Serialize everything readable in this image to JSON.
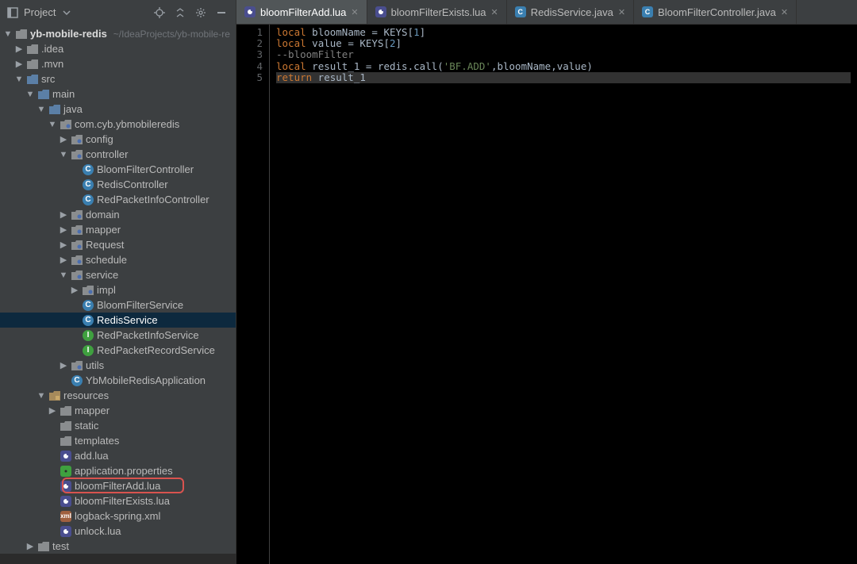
{
  "sidebar": {
    "title": "Project",
    "root": {
      "name": "yb-mobile-redis",
      "path": "~/IdeaProjects/yb-mobile-re"
    }
  },
  "tree": [
    {
      "depth": 1,
      "expand": "down",
      "icon": "folder",
      "label": ".idea"
    },
    {
      "depth": 1,
      "expand": "down",
      "icon": "folder",
      "label": ".mvn"
    },
    {
      "depth": 1,
      "expand": "open",
      "icon": "folder-blue",
      "label": "src"
    },
    {
      "depth": 2,
      "expand": "open",
      "icon": "folder-blue",
      "label": "main"
    },
    {
      "depth": 3,
      "expand": "open",
      "icon": "folder-blue",
      "label": "java"
    },
    {
      "depth": 4,
      "expand": "open",
      "icon": "package",
      "label": "com.cyb.ybmobileredis"
    },
    {
      "depth": 5,
      "expand": "down",
      "icon": "package",
      "label": "config"
    },
    {
      "depth": 5,
      "expand": "open",
      "icon": "package",
      "label": "controller"
    },
    {
      "depth": 6,
      "expand": "none",
      "icon": "class",
      "label": "BloomFilterController"
    },
    {
      "depth": 6,
      "expand": "none",
      "icon": "class",
      "label": "RedisController"
    },
    {
      "depth": 6,
      "expand": "none",
      "icon": "class",
      "label": "RedPacketInfoController"
    },
    {
      "depth": 5,
      "expand": "down",
      "icon": "package",
      "label": "domain"
    },
    {
      "depth": 5,
      "expand": "down",
      "icon": "package",
      "label": "mapper"
    },
    {
      "depth": 5,
      "expand": "down",
      "icon": "package",
      "label": "Request"
    },
    {
      "depth": 5,
      "expand": "down",
      "icon": "package",
      "label": "schedule"
    },
    {
      "depth": 5,
      "expand": "open",
      "icon": "package",
      "label": "service"
    },
    {
      "depth": 6,
      "expand": "down",
      "icon": "package",
      "label": "impl"
    },
    {
      "depth": 6,
      "expand": "none",
      "icon": "class",
      "label": "BloomFilterService"
    },
    {
      "depth": 6,
      "expand": "none",
      "icon": "class",
      "label": "RedisService",
      "sel": true
    },
    {
      "depth": 6,
      "expand": "none",
      "icon": "iface",
      "label": "RedPacketInfoService"
    },
    {
      "depth": 6,
      "expand": "none",
      "icon": "iface",
      "label": "RedPacketRecordService"
    },
    {
      "depth": 5,
      "expand": "down",
      "icon": "package",
      "label": "utils"
    },
    {
      "depth": 5,
      "expand": "none",
      "icon": "class",
      "label": "YbMobileRedisApplication"
    },
    {
      "depth": 3,
      "expand": "open",
      "icon": "resources",
      "label": "resources"
    },
    {
      "depth": 4,
      "expand": "down",
      "icon": "folder",
      "label": "mapper"
    },
    {
      "depth": 4,
      "expand": "none",
      "icon": "folder",
      "label": "static"
    },
    {
      "depth": 4,
      "expand": "none",
      "icon": "folder",
      "label": "templates"
    },
    {
      "depth": 4,
      "expand": "none",
      "icon": "lua",
      "label": "add.lua"
    },
    {
      "depth": 4,
      "expand": "none",
      "icon": "prop",
      "label": "application.properties"
    },
    {
      "depth": 4,
      "expand": "none",
      "icon": "lua",
      "label": "bloomFilterAdd.lua",
      "hl": true
    },
    {
      "depth": 4,
      "expand": "none",
      "icon": "lua",
      "label": "bloomFilterExists.lua"
    },
    {
      "depth": 4,
      "expand": "none",
      "icon": "xml",
      "label": "logback-spring.xml"
    },
    {
      "depth": 4,
      "expand": "none",
      "icon": "lua",
      "label": "unlock.lua"
    },
    {
      "depth": 2,
      "expand": "down",
      "icon": "folder",
      "label": "test"
    }
  ],
  "tabs": [
    {
      "icon": "lua",
      "label": "bloomFilterAdd.lua",
      "active": true
    },
    {
      "icon": "lua",
      "label": "bloomFilterExists.lua"
    },
    {
      "icon": "java",
      "label": "RedisService.java"
    },
    {
      "icon": "java",
      "label": "BloomFilterController.java"
    }
  ],
  "code": {
    "lines": [
      "1",
      "2",
      "3",
      "4",
      "5"
    ],
    "content": [
      [
        [
          "kw",
          "local"
        ],
        [
          "t",
          " bloomName = KEYS["
        ],
        [
          "num",
          "1"
        ],
        [
          "t",
          "]"
        ]
      ],
      [
        [
          "kw",
          "local"
        ],
        [
          "t",
          " value = KEYS["
        ],
        [
          "num",
          "2"
        ],
        [
          "t",
          "]"
        ]
      ],
      [
        [
          "cmt",
          "--bloomFilter"
        ]
      ],
      [
        [
          "kw",
          "local"
        ],
        [
          "t",
          " result_1 = redis.call("
        ],
        [
          "str",
          "'BF.ADD'"
        ],
        [
          "t",
          ",bloomName,value)"
        ]
      ],
      [
        [
          "kw",
          "return"
        ],
        [
          "t",
          " result_1"
        ]
      ]
    ],
    "currentLine": 5
  }
}
